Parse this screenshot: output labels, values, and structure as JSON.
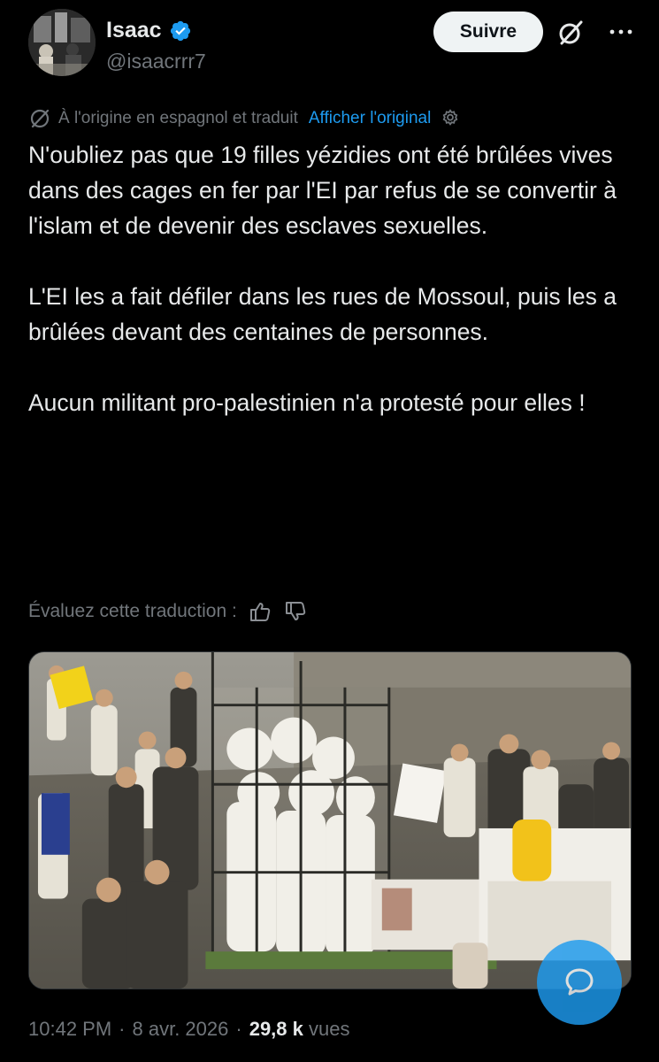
{
  "author": {
    "name": "Isaac",
    "handle": "@isaacrrr7",
    "verified": true
  },
  "actions": {
    "follow_label": "Suivre",
    "grok_icon": "grok-icon",
    "more_icon": "more-horizontal-icon"
  },
  "translation": {
    "origin_text": "À l'origine en espagnol et traduit",
    "show_original_label": "Afficher l'original",
    "rate_prompt": "Évaluez cette traduction :"
  },
  "tweet": {
    "paragraphs": [
      "N'oubliez pas que 19 filles yézidies ont été brûlées vives dans des cages en fer par l'EI par refus de se convertir à l'islam et de devenir des esclaves sexuelles.",
      "L'EI les a fait défiler dans les rues de Mossoul, puis les a brûlées devant des centaines de personnes.",
      "Aucun militant pro-palestinien n'a protesté pour elles !"
    ]
  },
  "meta": {
    "time": "10:42 PM",
    "separator": "·",
    "date": "8 avr. 2026",
    "views_count": "29,8 k",
    "views_label": "vues"
  },
  "colors": {
    "background": "#000000",
    "text_primary": "#e7e9ea",
    "text_secondary": "#71767b",
    "accent": "#1d9bf0",
    "follow_bg": "#eff3f4"
  }
}
